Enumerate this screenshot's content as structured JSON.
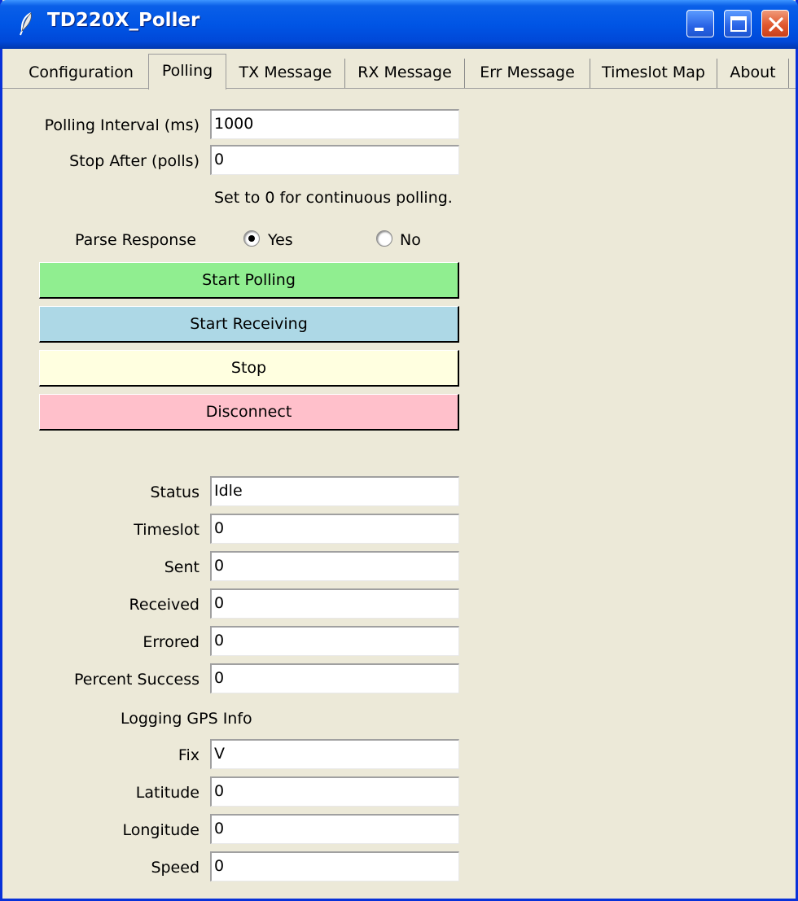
{
  "window": {
    "title": "TD220X_Poller"
  },
  "tabs": [
    {
      "label": "Configuration"
    },
    {
      "label": "Polling"
    },
    {
      "label": "TX Message"
    },
    {
      "label": "RX Message"
    },
    {
      "label": "Err Message"
    },
    {
      "label": "Timeslot Map"
    },
    {
      "label": "About"
    }
  ],
  "active_tab": "Polling",
  "polling": {
    "interval_label": "Polling Interval (ms)",
    "interval_value": "1000",
    "stop_after_label": "Stop After (polls)",
    "stop_after_value": "0",
    "hint": "Set to 0 for continuous polling.",
    "parse_label": "Parse Response",
    "parse_yes": "Yes",
    "parse_no": "No",
    "parse_selected": "Yes"
  },
  "buttons": {
    "start_polling": {
      "label": "Start Polling",
      "color": "#90EE90"
    },
    "start_receiving": {
      "label": "Start Receiving",
      "color": "#ADD8E6"
    },
    "stop": {
      "label": "Stop",
      "color": "#FFFFE0"
    },
    "disconnect": {
      "label": "Disconnect",
      "color": "#FFC0CB"
    }
  },
  "stats": {
    "status_label": "Status",
    "status_value": "Idle",
    "timeslot_label": "Timeslot",
    "timeslot_value": "0",
    "sent_label": "Sent",
    "sent_value": "0",
    "received_label": "Received",
    "received_value": "0",
    "errored_label": "Errored",
    "errored_value": "0",
    "percent_label": "Percent Success",
    "percent_value": "0"
  },
  "gps": {
    "heading": "Logging GPS Info",
    "fix_label": "Fix",
    "fix_value": "V",
    "latitude_label": "Latitude",
    "latitude_value": "0",
    "longitude_label": "Longitude",
    "longitude_value": "0",
    "speed_label": "Speed",
    "speed_value": "0"
  },
  "colors": {
    "titlebar": "#0055E5",
    "background": "#ECE9D8",
    "close_button": "#E0582F"
  }
}
